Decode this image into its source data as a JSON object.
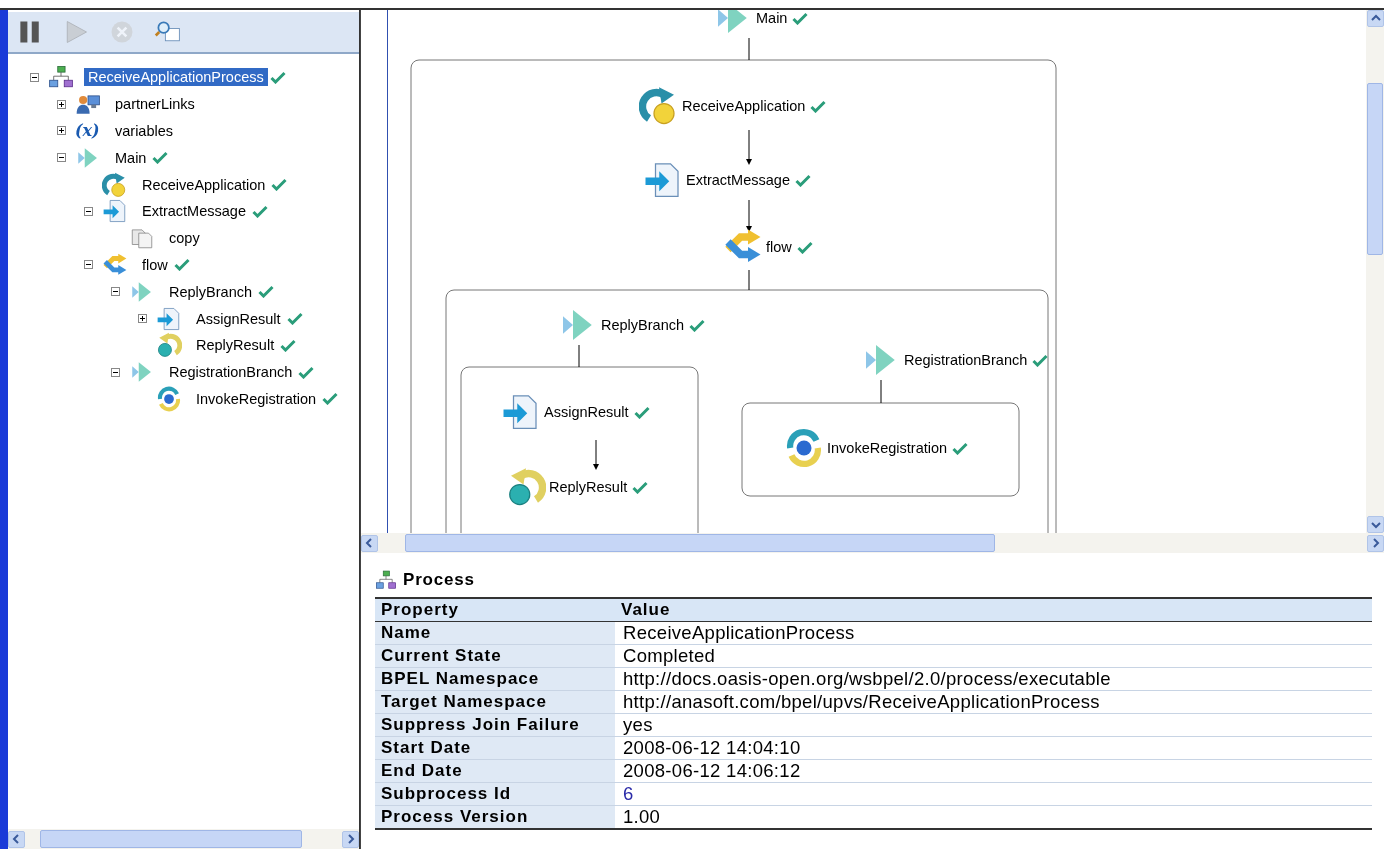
{
  "toolbar": [
    {
      "kind": "pause",
      "disabled": false
    },
    {
      "kind": "play",
      "disabled": true
    },
    {
      "kind": "stop",
      "disabled": true
    },
    {
      "kind": "find",
      "disabled": false
    }
  ],
  "tree": {
    "items": [
      {
        "label": "ReceiveApplicationProcess",
        "kind": "process",
        "expandable": true,
        "expanded": true,
        "completed": true,
        "selected": true,
        "children": [
          {
            "label": "partnerLinks",
            "kind": "partners",
            "expandable": true,
            "expanded": false,
            "completed": false,
            "selected": false
          },
          {
            "label": "variables",
            "kind": "variables",
            "icon_text": "(x)",
            "expandable": true,
            "expanded": false,
            "completed": false,
            "selected": false
          },
          {
            "label": "Main",
            "kind": "sequence",
            "expandable": true,
            "expanded": true,
            "completed": true,
            "selected": false,
            "children": [
              {
                "label": "ReceiveApplication",
                "kind": "receive",
                "expandable": false,
                "completed": true,
                "selected": false
              },
              {
                "label": "ExtractMessage",
                "kind": "assign",
                "expandable": true,
                "expanded": true,
                "completed": true,
                "selected": false,
                "children": [
                  {
                    "label": "copy",
                    "kind": "copy",
                    "expandable": false,
                    "completed": false,
                    "selected": false
                  }
                ]
              },
              {
                "label": "flow",
                "kind": "flow",
                "expandable": true,
                "expanded": true,
                "completed": true,
                "selected": false,
                "children": [
                  {
                    "label": "ReplyBranch",
                    "kind": "sequence",
                    "expandable": true,
                    "expanded": true,
                    "completed": true,
                    "selected": false,
                    "children": [
                      {
                        "label": "AssignResult",
                        "kind": "assign",
                        "expandable": true,
                        "expanded": false,
                        "completed": true,
                        "selected": false
                      },
                      {
                        "label": "ReplyResult",
                        "kind": "reply",
                        "expandable": false,
                        "completed": true,
                        "selected": false
                      }
                    ]
                  },
                  {
                    "label": "RegistrationBranch",
                    "kind": "sequence",
                    "expandable": true,
                    "expanded": true,
                    "completed": true,
                    "selected": false,
                    "children": [
                      {
                        "label": "InvokeRegistration",
                        "kind": "invoke",
                        "expandable": false,
                        "completed": true,
                        "selected": false
                      }
                    ]
                  }
                ]
              }
            ]
          }
        ]
      }
    ]
  },
  "diagram": {
    "nodes": [
      {
        "label": "Main",
        "kind": "sequence",
        "completed": true
      },
      {
        "label": "ReceiveApplication",
        "kind": "receive",
        "completed": true
      },
      {
        "label": "ExtractMessage",
        "kind": "assign",
        "completed": true
      },
      {
        "label": "flow",
        "kind": "flow",
        "completed": true
      },
      {
        "label": "ReplyBranch",
        "kind": "sequence",
        "completed": true
      },
      {
        "label": "AssignResult",
        "kind": "assign",
        "completed": true
      },
      {
        "label": "ReplyResult",
        "kind": "reply",
        "completed": true
      },
      {
        "label": "RegistrationBranch",
        "kind": "sequence",
        "completed": true
      },
      {
        "label": "InvokeRegistration",
        "kind": "invoke",
        "completed": true
      }
    ]
  },
  "properties": {
    "title": "Process",
    "columns": [
      "Property",
      "Value"
    ],
    "rows": [
      {
        "property": "Name",
        "value": "ReceiveApplicationProcess",
        "kind": "text"
      },
      {
        "property": "Current State",
        "value": "Completed",
        "kind": "text"
      },
      {
        "property": "BPEL Namespace",
        "value": "http://docs.oasis-open.org/wsbpel/2.0/process/executable",
        "kind": "text"
      },
      {
        "property": "Target Namespace",
        "value": "http://anasoft.com/bpel/upvs/ReceiveApplicationProcess",
        "kind": "text"
      },
      {
        "property": "Suppress Join Failure",
        "value": "yes",
        "kind": "text"
      },
      {
        "property": "Start Date",
        "value": "2008-06-12 14:04:10",
        "kind": "text"
      },
      {
        "property": "End Date",
        "value": "2008-06-12 14:06:12",
        "kind": "text"
      },
      {
        "property": "Subprocess Id",
        "value": "6",
        "kind": "link"
      },
      {
        "property": "Process Version",
        "value": "1.00",
        "kind": "text"
      }
    ]
  }
}
